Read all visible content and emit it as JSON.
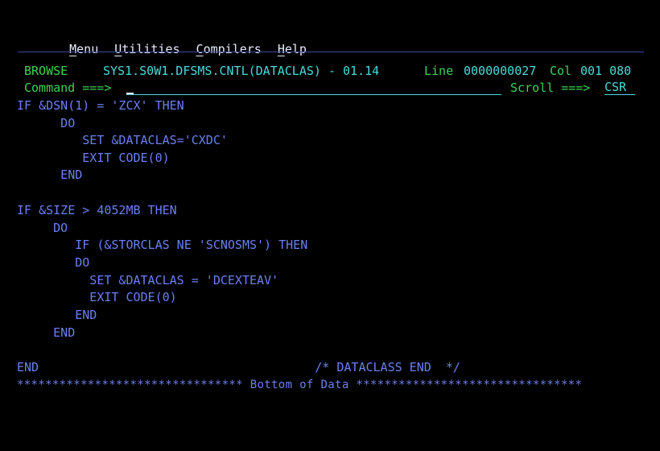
{
  "menu": {
    "items": [
      {
        "mnemonic": "M",
        "rest": "enu"
      },
      {
        "mnemonic": "U",
        "rest": "tilities"
      },
      {
        "mnemonic": "C",
        "rest": "ompilers"
      },
      {
        "mnemonic": "H",
        "rest": "elp"
      }
    ]
  },
  "header": {
    "mode": "BROWSE",
    "dataset": "SYS1.S0W1.DFSMS.CNTL(DATACLAS) - 01.14",
    "line_label": "Line",
    "line_value": "0000000027",
    "col_label": "Col",
    "col_value": "001 080",
    "command_label": "Command ===>",
    "command_value": "",
    "scroll_label": "Scroll ===>",
    "scroll_value": "CSR"
  },
  "code_lines": [
    "IF &DSN(1) = 'ZCX' THEN",
    "      DO",
    "         SET &DATACLAS='CXDC'",
    "         EXIT CODE(0)",
    "      END",
    "",
    "IF &SIZE > 4052MB THEN",
    "     DO",
    "        IF (&STORCLAS NE 'SCNOSMS') THEN",
    "        DO",
    "          SET &DATACLAS = 'DCEXTEAV'",
    "          EXIT CODE(0)",
    "        END",
    "     END",
    "",
    "END                                      /* DATACLASS END  */"
  ],
  "footer": "******************************** Bottom of Data ********************************",
  "colors": {
    "background": "#000000",
    "text_blue": "#6b7ff0",
    "label_green": "#3cd25a",
    "field_turquoise": "#49d9d9",
    "menu_white": "#e8ecff"
  }
}
